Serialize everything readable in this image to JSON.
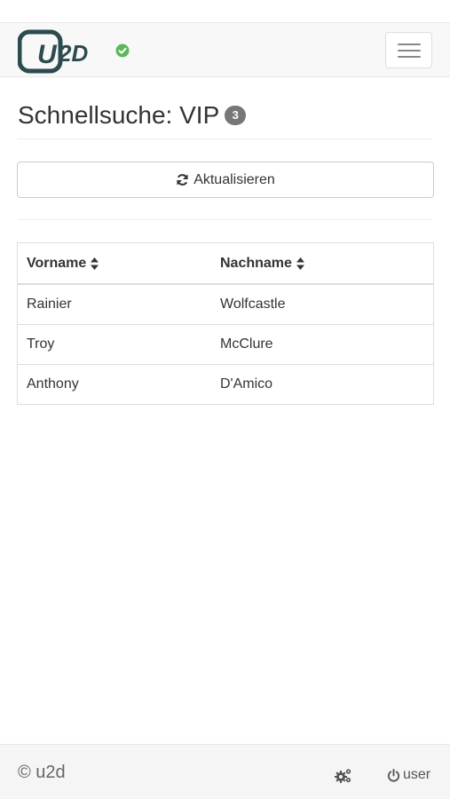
{
  "navbar": {
    "logo_icon": "u2d-logo",
    "status_icon": "check-circle-icon",
    "status_color": "#5cb85c",
    "menu_icon": "hamburger-icon"
  },
  "page": {
    "title": "Schnellsuche: VIP",
    "count": "3"
  },
  "toolbar": {
    "refresh_label": "Aktualisieren",
    "refresh_icon": "refresh-icon"
  },
  "table": {
    "columns": [
      "Vorname",
      "Nachname"
    ],
    "rows": [
      [
        "Rainier",
        "Wolfcastle"
      ],
      [
        "Troy",
        "McClure"
      ],
      [
        "Anthony",
        "D'Amico"
      ]
    ]
  },
  "footer": {
    "copyright": "© u2d",
    "settings_icon": "cogs-icon",
    "user_label": "user",
    "user_icon": "power-icon"
  },
  "colors": {
    "brand": "#2d4a4f",
    "badge": "#777777"
  }
}
